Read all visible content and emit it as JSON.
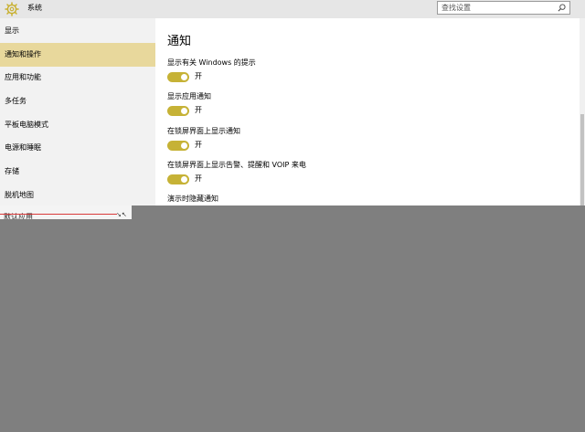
{
  "window": {
    "title": "系统",
    "search": {
      "placeholder": "查找设置"
    }
  },
  "sidebar": {
    "items": [
      {
        "label": "显示",
        "active": false
      },
      {
        "label": "通知和操作",
        "active": true
      },
      {
        "label": "应用和功能",
        "active": false
      },
      {
        "label": "多任务",
        "active": false
      },
      {
        "label": "平板电脑模式",
        "active": false
      },
      {
        "label": "电源和睡眠",
        "active": false
      },
      {
        "label": "存储",
        "active": false
      },
      {
        "label": "脱机地图",
        "active": false
      },
      {
        "label": "默认应用",
        "active": false
      }
    ]
  },
  "main": {
    "heading": "通知",
    "settings": [
      {
        "label": "显示有关 Windows 的提示",
        "state": "开"
      },
      {
        "label": "显示应用通知",
        "state": "开"
      },
      {
        "label": "在锁屏界面上显示通知",
        "state": "开"
      },
      {
        "label": "在锁屏界面上显示告警、提醒和 VOIP 来电",
        "state": "开"
      },
      {
        "label": "演示时隐藏通知"
      }
    ]
  },
  "colors": {
    "accent": "#c6b236",
    "selected_nav": "#e8d89c",
    "sidebar_bg": "#f2f2f2",
    "overlay": "#7f7f7f"
  },
  "icons": {
    "app": "gear-icon",
    "search": "search-icon",
    "fragment_mark": "resize-arrows-icon"
  }
}
